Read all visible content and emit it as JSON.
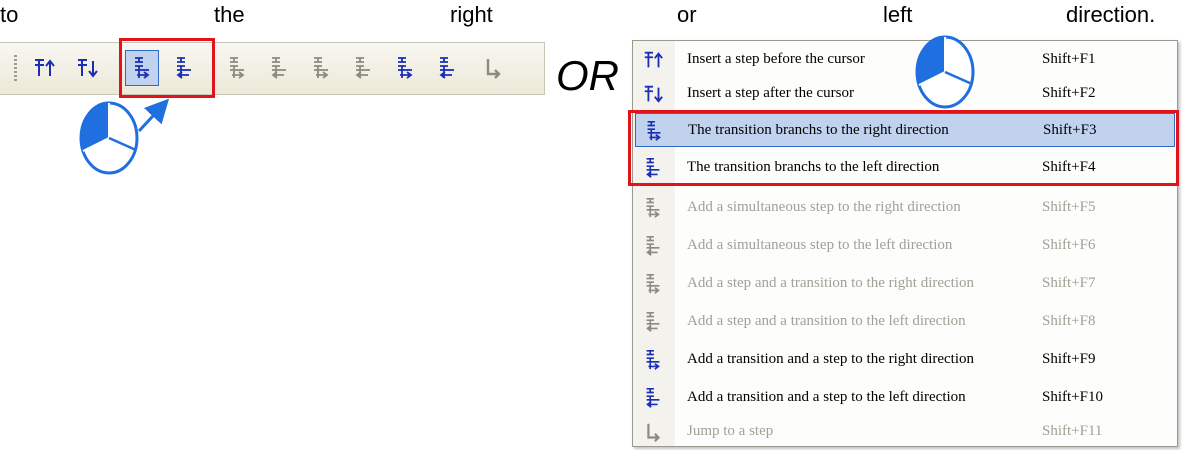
{
  "sentence": {
    "w1": "to",
    "w2": "the",
    "w3": "right",
    "w4": "or",
    "w5": "left",
    "w6": "direction."
  },
  "or_label": "OR",
  "colors": {
    "highlight": "#c1d2ee",
    "highlight_border": "#316ac5",
    "red": "#e0151b",
    "icon_blue": "#1a2fb5",
    "disabled_icon": "#8c8a82",
    "pie_blue": "#1f6fe0"
  },
  "toolbar": {
    "buttons": [
      {
        "icon": "insert-step-before-icon",
        "enabled": true
      },
      {
        "icon": "insert-step-after-icon",
        "enabled": true
      },
      {
        "icon": "transition-branch-right-icon",
        "enabled": true,
        "pressed": true
      },
      {
        "icon": "transition-branch-left-icon",
        "enabled": true
      },
      {
        "icon": "simultaneous-step-right-icon",
        "enabled": false
      },
      {
        "icon": "simultaneous-step-left-icon",
        "enabled": false
      },
      {
        "icon": "step-transition-right-icon",
        "enabled": false
      },
      {
        "icon": "step-transition-left-icon",
        "enabled": false
      },
      {
        "icon": "transition-step-right-icon",
        "enabled": true
      },
      {
        "icon": "transition-step-left-icon",
        "enabled": true
      },
      {
        "icon": "jump-to-step-icon",
        "enabled": false
      }
    ]
  },
  "menu": {
    "items": [
      {
        "label": "Insert a step before the cursor",
        "shortcut": "Shift+F1",
        "enabled": true,
        "icon": "insert-step-before-icon"
      },
      {
        "label": "Insert a step after the cursor",
        "shortcut": "Shift+F2",
        "enabled": true,
        "icon": "insert-step-after-icon"
      },
      {
        "label": "The transition branchs to the right direction",
        "shortcut": "Shift+F3",
        "enabled": true,
        "selected": true,
        "icon": "transition-branch-right-icon"
      },
      {
        "label": "The transition branchs to the left direction",
        "shortcut": "Shift+F4",
        "enabled": true,
        "icon": "transition-branch-left-icon"
      },
      {
        "label": "Add a simultaneous step to the right direction",
        "shortcut": "Shift+F5",
        "enabled": false,
        "icon": "simultaneous-step-right-icon"
      },
      {
        "label": "Add a simultaneous step to the left direction",
        "shortcut": "Shift+F6",
        "enabled": false,
        "icon": "simultaneous-step-left-icon"
      },
      {
        "label": "Add a step and a transition to the right direction",
        "shortcut": "Shift+F7",
        "enabled": false,
        "icon": "step-transition-right-icon"
      },
      {
        "label": "Add a step and a transition to the left direction",
        "shortcut": "Shift+F8",
        "enabled": false,
        "icon": "step-transition-left-icon"
      },
      {
        "label": "Add a transition and a step to the right direction",
        "shortcut": "Shift+F9",
        "enabled": true,
        "icon": "transition-step-right-icon"
      },
      {
        "label": "Add a transition and a step to the left direction",
        "shortcut": "Shift+F10",
        "enabled": true,
        "icon": "transition-step-left-icon"
      },
      {
        "label": "Jump to a step",
        "shortcut": "Shift+F11",
        "enabled": false,
        "icon": "jump-to-step-icon"
      }
    ]
  }
}
